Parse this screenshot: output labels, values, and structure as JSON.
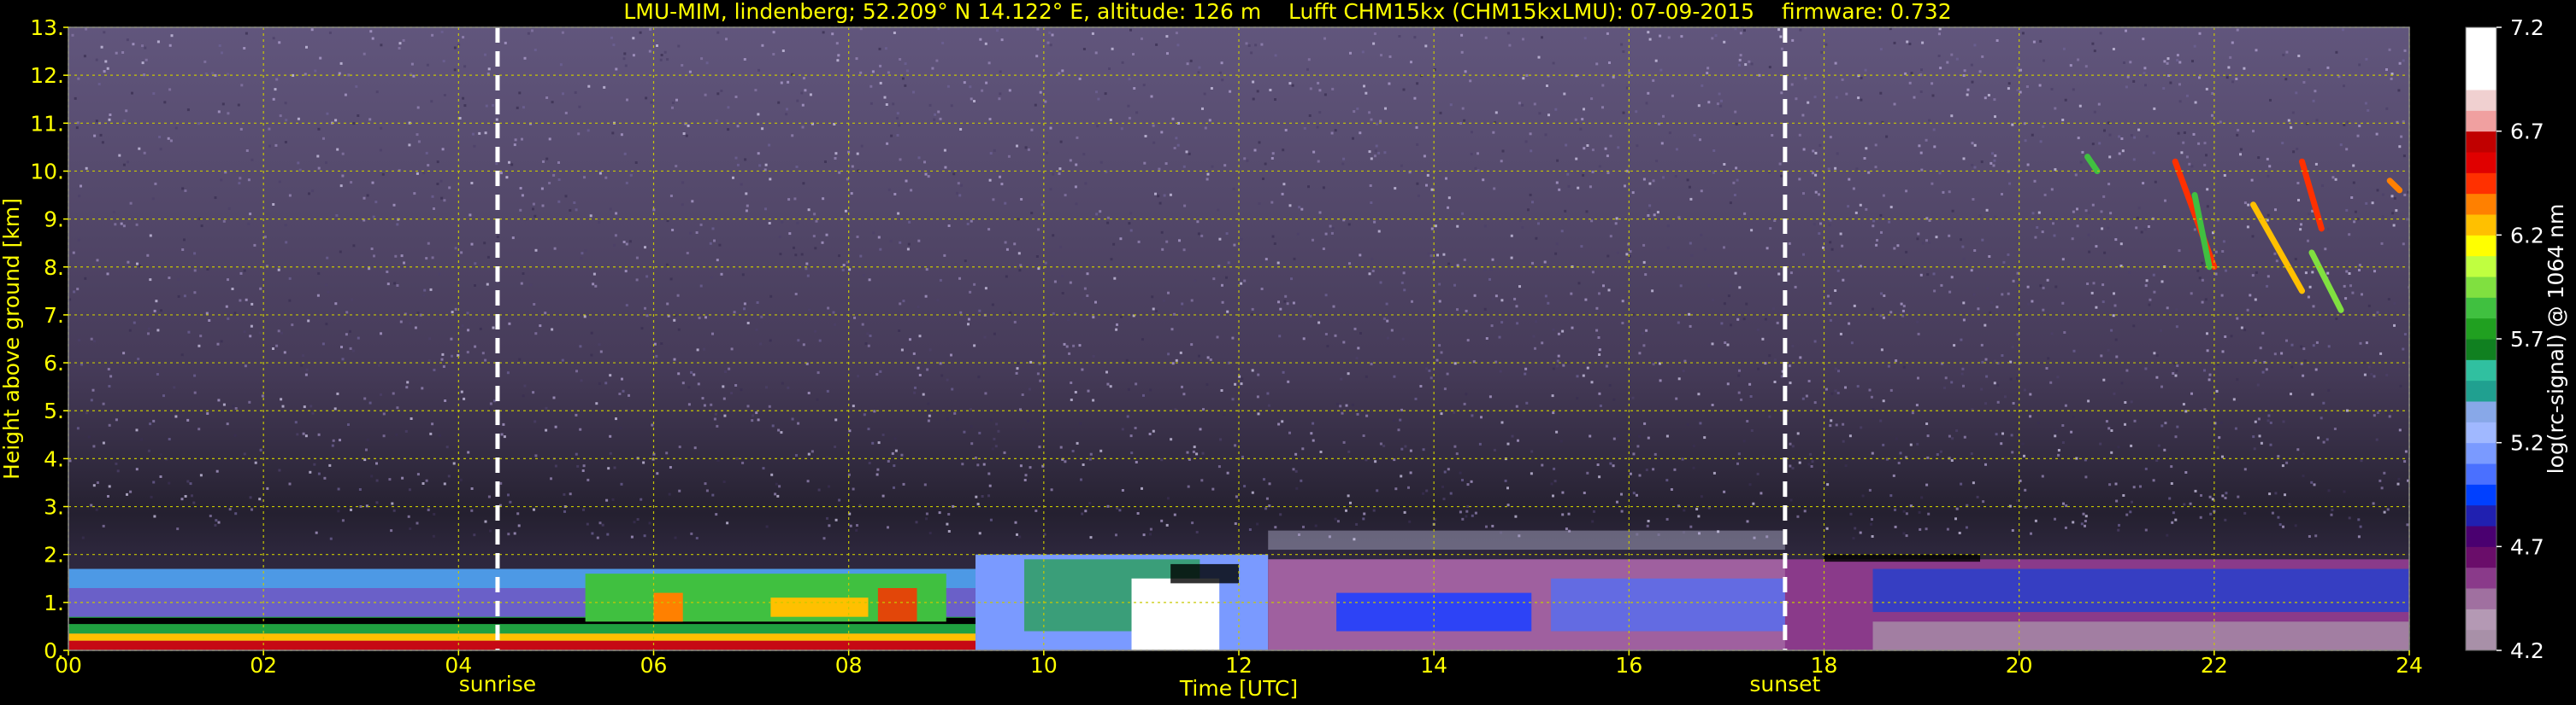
{
  "chart_data": {
    "type": "heatmap",
    "title": "LMU-MIM, lindenberg; 52.209° N 14.122° E, altitude: 126 m    Lufft CHM15kx (CHM15kxLMU): 07-09-2015    firmware: 0.732",
    "xlabel": "Time [UTC]",
    "ylabel": "Height above ground [km]",
    "xlim": [
      0,
      24
    ],
    "ylim": [
      0,
      13
    ],
    "x_ticks": [
      "00",
      "02",
      "04",
      "06",
      "08",
      "10",
      "12",
      "14",
      "16",
      "18",
      "20",
      "22",
      "24"
    ],
    "x_tick_values": [
      0,
      2,
      4,
      6,
      8,
      10,
      12,
      14,
      16,
      18,
      20,
      22,
      24
    ],
    "y_ticks": [
      "0.",
      "1.",
      "2.",
      "3.",
      "4.",
      "5.",
      "6.",
      "7.",
      "8.",
      "9.",
      "10.",
      "11.",
      "12.",
      "13."
    ],
    "y_tick_values": [
      0,
      1,
      2,
      3,
      4,
      5,
      6,
      7,
      8,
      9,
      10,
      11,
      12,
      13
    ],
    "grid": true,
    "sunrise": {
      "label": "sunrise",
      "time": 4.4
    },
    "sunset": {
      "label": "sunset",
      "time": 17.6
    },
    "colorbar": {
      "label": "log(rc-signal) @ 1064 nm",
      "min": 4.2,
      "max": 7.2,
      "ticks": [
        "7.2",
        "6.7",
        "6.2",
        "5.7",
        "5.2",
        "4.7",
        "4.2"
      ],
      "tick_values": [
        7.2,
        6.7,
        6.2,
        5.7,
        5.2,
        4.7,
        4.2
      ],
      "colors": [
        "#a890a8",
        "#b499b4",
        "#a070a0",
        "#8a3a8a",
        "#6a0d6a",
        "#4a0070",
        "#2020b0",
        "#0040ff",
        "#4a70ff",
        "#7a9aff",
        "#a0b8ff",
        "#88a8e8",
        "#20a090",
        "#30c0a0",
        "#108020",
        "#20a020",
        "#40c040",
        "#80e040",
        "#c0ff40",
        "#ffff00",
        "#ffc000",
        "#ff8000",
        "#ff3000",
        "#e00000",
        "#c00000",
        "#f0a0a0",
        "#f0d0d0",
        "#ffffff",
        "#ffffff",
        "#ffffff"
      ]
    }
  },
  "colors": {
    "background": "#000000",
    "text": "#ffff00",
    "grid": "#c8c800",
    "marker": "#ffffff",
    "colorbar_text": "#ffffff"
  }
}
